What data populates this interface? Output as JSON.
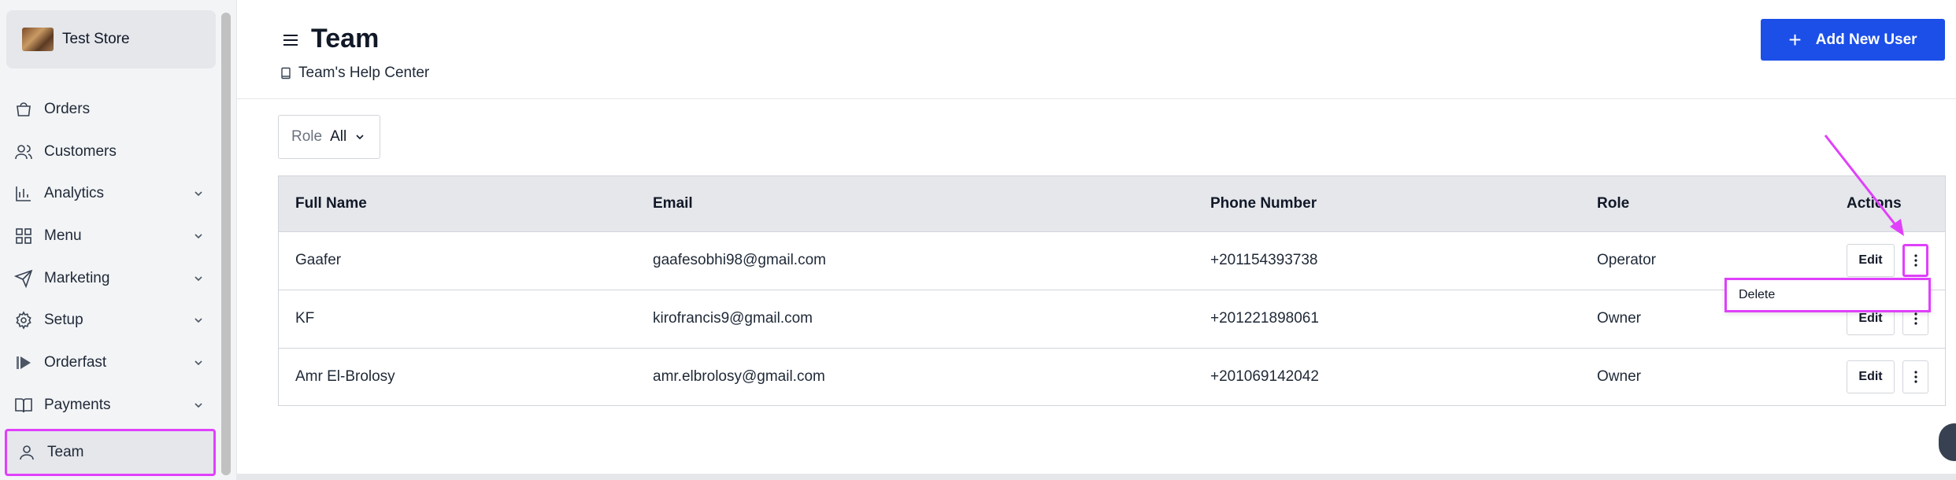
{
  "store": {
    "name": "Test Store"
  },
  "sidebar": {
    "items": [
      {
        "label": "Orders",
        "icon": "shopping-bag-icon",
        "has_chevron": false
      },
      {
        "label": "Customers",
        "icon": "users-icon",
        "has_chevron": false
      },
      {
        "label": "Analytics",
        "icon": "bar-chart-icon",
        "has_chevron": true
      },
      {
        "label": "Menu",
        "icon": "grid-icon",
        "has_chevron": true
      },
      {
        "label": "Marketing",
        "icon": "send-icon",
        "has_chevron": true
      },
      {
        "label": "Setup",
        "icon": "gear-icon",
        "has_chevron": true
      },
      {
        "label": "Orderfast",
        "icon": "orderfast-logo-icon",
        "has_chevron": true
      },
      {
        "label": "Payments",
        "icon": "book-icon",
        "has_chevron": true
      },
      {
        "label": "Team",
        "icon": "user-icon",
        "has_chevron": false,
        "active": true
      }
    ]
  },
  "header": {
    "title": "Team",
    "help_link": "Team's Help Center",
    "add_button": "Add New User"
  },
  "filter": {
    "label": "Role",
    "value": "All"
  },
  "table": {
    "columns": [
      "Full Name",
      "Email",
      "Phone Number",
      "Role",
      "Actions"
    ],
    "rows": [
      {
        "name": "Gaafer",
        "email": "gaafesobhi98@gmail.com",
        "phone": "+201154393738",
        "role": "Operator"
      },
      {
        "name": "KF",
        "email": "kirofrancis9@gmail.com",
        "phone": "+201221898061",
        "role": "Owner"
      },
      {
        "name": "Amr El-Brolosy",
        "email": "amr.elbrolosy@gmail.com",
        "phone": "+201069142042",
        "role": "Owner"
      }
    ],
    "edit_label": "Edit"
  },
  "dropdown": {
    "delete_label": "Delete"
  },
  "colors": {
    "accent": "#1c4fe8",
    "highlight": "#e040fb",
    "sidebar_bg": "#f3f4f6"
  }
}
